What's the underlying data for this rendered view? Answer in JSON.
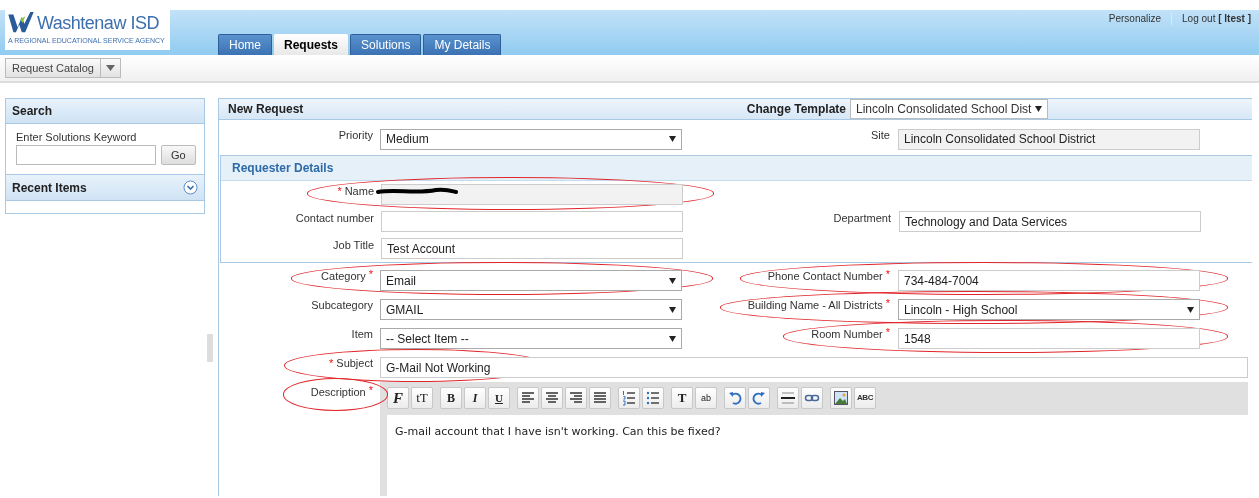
{
  "header": {
    "logo": {
      "name": "Washtenaw ISD",
      "tagline": "A REGIONAL EDUCATIONAL SERVICE AGENCY"
    },
    "links": [
      "Personalize",
      "Log out **[ ltest ]**"
    ],
    "tabs": [
      {
        "label": "Home",
        "selected": false
      },
      {
        "label": "Requests",
        "selected": true
      },
      {
        "label": "Solutions",
        "selected": false
      },
      {
        "label": "My Details",
        "selected": false
      }
    ]
  },
  "toolbar": {
    "button": "Request Catalog"
  },
  "sidebar": {
    "search": {
      "title": "Search",
      "field_label": "Enter Solutions Keyword",
      "button": "Go"
    },
    "recent": {
      "title": "Recent Items"
    }
  },
  "form": {
    "title": "New Request",
    "template": {
      "label": "Change Template",
      "value": "Lincoln Consolidated School Dist"
    },
    "top_rows": [
      {
        "left": {
          "label": "Priority",
          "kind": "select",
          "value": "Medium"
        },
        "right": {
          "label": "Site",
          "kind": "readonly",
          "value": "Lincoln Consolidated School District"
        }
      }
    ],
    "requester": {
      "title": "Requester Details",
      "rows": [
        {
          "left": {
            "label": "Name",
            "kind": "readonly",
            "asterisk": "*",
            "asterisk_before": true,
            "circled": true,
            "redacted": true
          }
        },
        {
          "left": {
            "label": "Contact number",
            "kind": "text"
          },
          "right": {
            "label": "Department",
            "kind": "text",
            "value": "Technology and Data Services"
          }
        },
        {
          "left": {
            "label": "Job Title",
            "kind": "text",
            "value": "Test Account"
          }
        }
      ]
    },
    "rows": [
      {
        "left": {
          "label": "Category",
          "kind": "select",
          "value": "Email",
          "asterisk": "*",
          "asterisk_before": false,
          "circled": true
        },
        "right": {
          "label": "Phone Contact Number",
          "kind": "text",
          "value": "734-484-7004",
          "asterisk": "*",
          "asterisk_before": false,
          "circled": true
        }
      },
      {
        "left": {
          "label": "Subcategory",
          "kind": "select",
          "value": "GMAIL"
        },
        "right": {
          "label": "Building Name - All Districts",
          "kind": "select",
          "value": "Lincoln - High School",
          "asterisk": "*",
          "asterisk_before": false,
          "circled": true
        }
      },
      {
        "left": {
          "label": "Item",
          "kind": "select",
          "value": "-- Select Item --"
        },
        "right": {
          "label": "Room Number",
          "kind": "text",
          "value": "1548",
          "asterisk": "*",
          "asterisk_before": false,
          "circled": true
        }
      },
      {
        "left": {
          "label": "Subject",
          "kind": "text",
          "value": "G-Mail Not Working",
          "asterisk": "*",
          "asterisk_before": true,
          "circled": true,
          "wide": true
        }
      }
    ],
    "description": {
      "label": "Description",
      "asterisk": "*",
      "asterisk_before": false,
      "circled": true,
      "toolbar": [
        [
          {
            "kind": "font",
            "glyph": "F"
          },
          {
            "kind": "fontsize",
            "glyph": "tT"
          }
        ],
        [
          {
            "kind": "bold",
            "glyph": "B"
          },
          {
            "kind": "italic",
            "glyph": "I"
          },
          {
            "kind": "underline",
            "glyph": "U"
          }
        ],
        [
          {
            "kind": "align-left"
          },
          {
            "kind": "align-center"
          },
          {
            "kind": "align-right"
          },
          {
            "kind": "align-justify"
          }
        ],
        [
          {
            "kind": "numbered-list"
          },
          {
            "kind": "bullet-list"
          }
        ],
        [
          {
            "kind": "text-color",
            "glyph": "T"
          },
          {
            "kind": "highlight",
            "glyph": "ab"
          }
        ],
        [
          {
            "kind": "undo"
          },
          {
            "kind": "redo"
          }
        ],
        [
          {
            "kind": "horizontal-rule"
          },
          {
            "kind": "link"
          }
        ],
        [
          {
            "kind": "image"
          },
          {
            "kind": "spellcheck",
            "glyph": "ABC"
          }
        ]
      ],
      "text": "G-mail account that I have isn't working. Can this be fixed?"
    }
  }
}
